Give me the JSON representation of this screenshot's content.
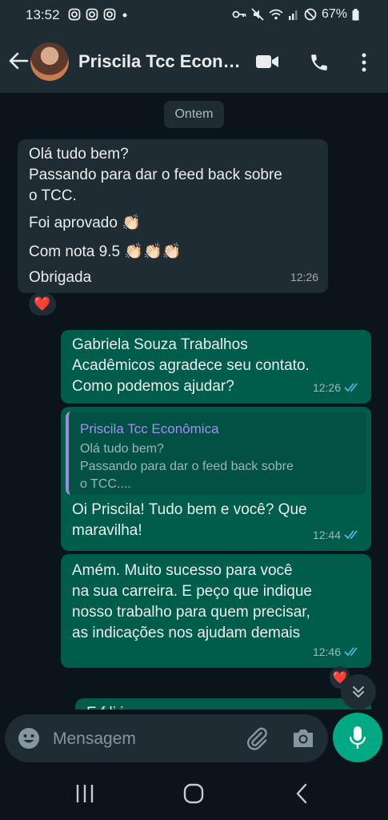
{
  "status_bar": {
    "time": "13:52",
    "battery": "67%",
    "notification_icons": [
      "instagram-icon",
      "instagram-icon",
      "instagram-icon"
    ],
    "system_icons": [
      "key-icon",
      "mute-icon",
      "wifi-icon",
      "signal-icon",
      "dnd-icon",
      "battery-icon"
    ]
  },
  "header": {
    "title": "Priscila Tcc Econ…",
    "icons": [
      "back-arrow-icon",
      "video-call-icon",
      "voice-call-icon",
      "more-options-icon"
    ]
  },
  "chat": {
    "date_chip": "Ontem",
    "messages": [
      {
        "direction": "incoming",
        "lines": [
          "Olá tudo bem?",
          "Passando para dar o feed back sobre",
          "o TCC.",
          "Foi aprovado 👏🏻",
          "Com nota 9.5 👏🏻👏🏻👏🏻",
          "Obrigada"
        ],
        "time": "12:26",
        "reaction": "❤️"
      },
      {
        "direction": "outgoing",
        "lines": [
          "Gabriela Souza Trabalhos",
          "Acadêmicos agradece seu contato.",
          "Como podemos ajudar?"
        ],
        "time": "12:26",
        "status": "read"
      },
      {
        "direction": "outgoing",
        "quote": {
          "author": "Priscila Tcc Econômica",
          "lines": [
            "Olá tudo bem?",
            "Passando para dar o feed back sobre",
            "o TCC...."
          ]
        },
        "lines": [
          "Oi Priscila! Tudo bem e você? Que",
          "maravilha!"
        ],
        "time": "12:44",
        "status": "read"
      },
      {
        "direction": "outgoing",
        "lines": [
          "Amém. Muito sucesso para você",
          "na sua carreira. E peço que indique",
          "nosso trabalho para quem precisar,",
          "as indicações nos ajudam demais"
        ],
        "time": "12:46",
        "status": "read",
        "reaction": "❤️"
      }
    ],
    "partial_next_line": "E                    f   li   i"
  },
  "composer": {
    "placeholder": "Mensagem"
  },
  "colors": {
    "header_bg": "#1f2c34",
    "chat_bg": "#0b141a",
    "incoming_bubble": "#202c33",
    "outgoing_bubble": "#005c4b",
    "accent": "#00a884",
    "read_tick": "#53bdeb"
  }
}
